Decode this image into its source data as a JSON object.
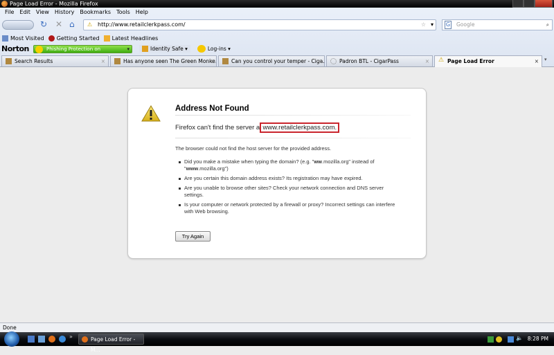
{
  "window": {
    "title": "Page Load Error - Mozilla Firefox"
  },
  "menu": [
    "File",
    "Edit",
    "View",
    "History",
    "Bookmarks",
    "Tools",
    "Help"
  ],
  "nav": {
    "url": "http://www.retailclerkpass.com/",
    "search_placeholder": "Google",
    "search_engine": "G"
  },
  "bookmarks": [
    "Most Visited",
    "Getting Started",
    "Latest Headlines"
  ],
  "norton": {
    "logo": "Norton",
    "phishing": "Phishing Protection on",
    "identity": "Identity Safe ▾",
    "logins": "Log-ins ▾"
  },
  "tabs": [
    {
      "label": "Search Results",
      "active": false
    },
    {
      "label": "Has anyone seen The Green Monke...",
      "active": false
    },
    {
      "label": "Can you control your temper - Ciga...",
      "active": false
    },
    {
      "label": "Padron BTL - CigarPass",
      "active": false
    },
    {
      "label": "Page Load Error",
      "active": true
    }
  ],
  "error": {
    "title": "Address Not Found",
    "message_prefix": "Firefox can't find the server at",
    "server": "www.retailclerkpass.com.",
    "description": "The browser could not find the host server for the provided address.",
    "bullet1": {
      "a": "Did you make a mistake when typing the domain? (e.g. \"",
      "b": "ww",
      "c": ".mozilla.org\" instead of \"",
      "d": "www",
      "e": ".mozilla.org\")"
    },
    "bullets": [
      "Are you certain this domain address exists? Its registration may have expired.",
      "Are you unable to browse other sites? Check your network connection and DNS server settings.",
      "Is your computer or network protected by a firewall or proxy? Incorrect settings can interfere with Web browsing."
    ],
    "try_again": "Try Again"
  },
  "status": "Done",
  "taskbar": {
    "button": "Page Load Error - M...",
    "clock": "8:28 PM",
    "more": "»"
  },
  "colors": {
    "highlight_box": "#c9242c",
    "phishing_bar": "#3fae12"
  }
}
